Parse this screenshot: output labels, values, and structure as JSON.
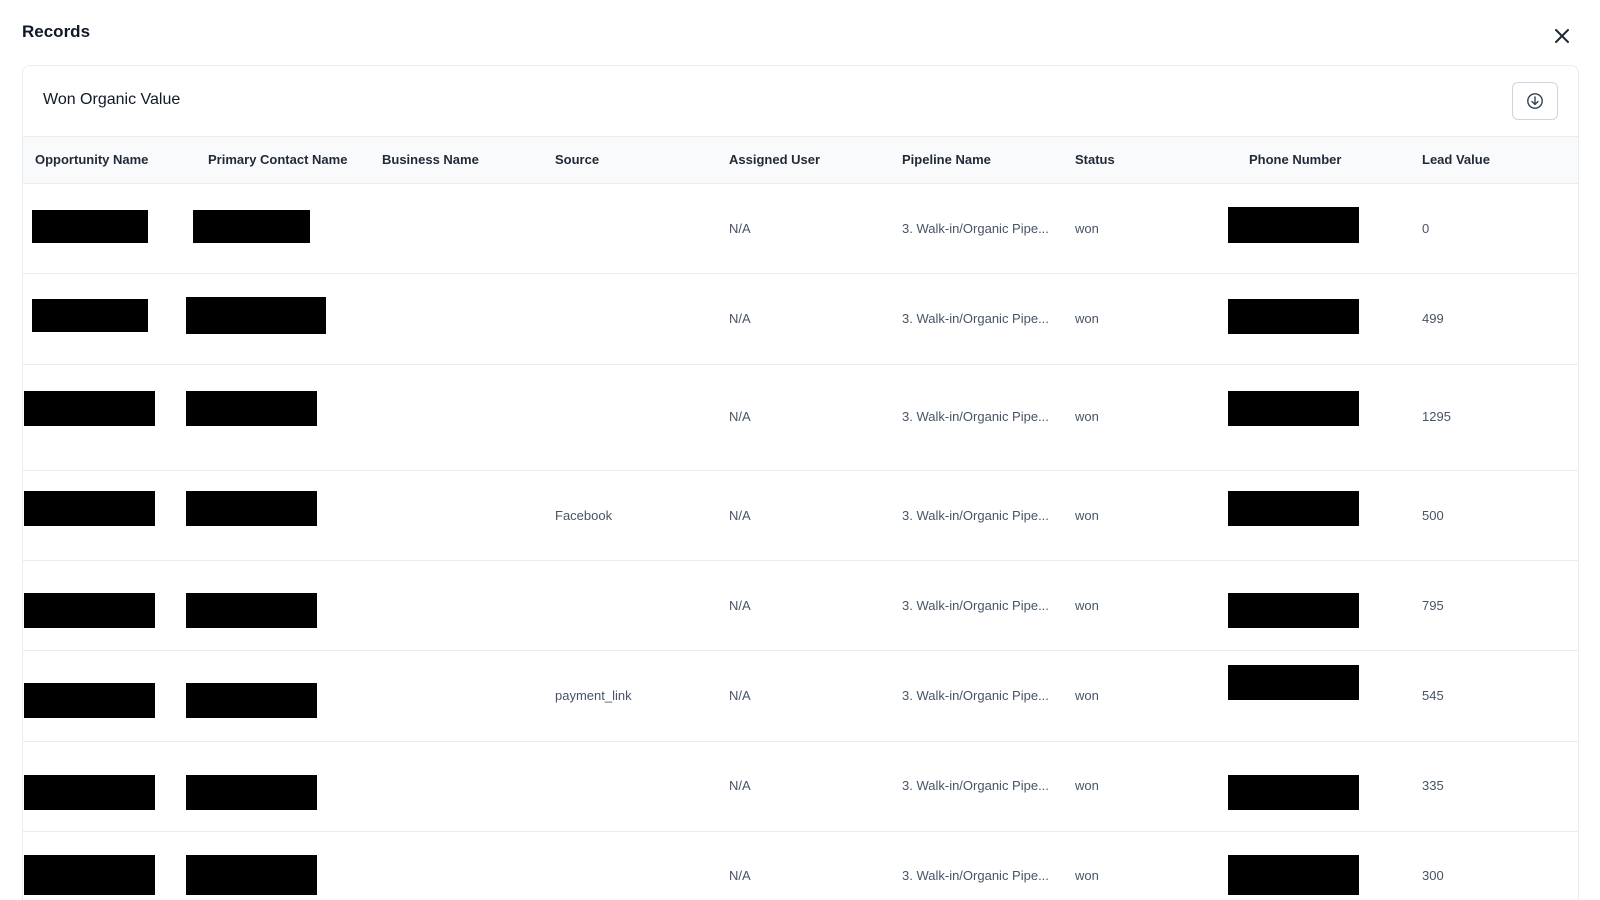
{
  "modal": {
    "title": "Records"
  },
  "card": {
    "title": "Won Organic Value"
  },
  "icons": {
    "close": "close-icon",
    "download": "download-icon"
  },
  "table": {
    "columns": [
      "Opportunity Name",
      "Primary Contact Name",
      "Business Name",
      "Source",
      "Assigned User",
      "Pipeline Name",
      "Status",
      "Phone Number",
      "Lead Value"
    ],
    "rows": [
      {
        "source": "",
        "assigned_user": "N/A",
        "pipeline": "3. Walk-in/Organic Pipe...",
        "status": "won",
        "lead_value": "0"
      },
      {
        "source": "",
        "assigned_user": "N/A",
        "pipeline": "3. Walk-in/Organic Pipe...",
        "status": "won",
        "lead_value": "499"
      },
      {
        "source": "",
        "assigned_user": "N/A",
        "pipeline": "3. Walk-in/Organic Pipe...",
        "status": "won",
        "lead_value": "1295"
      },
      {
        "source": "Facebook",
        "assigned_user": "N/A",
        "pipeline": "3. Walk-in/Organic Pipe...",
        "status": "won",
        "lead_value": "500"
      },
      {
        "source": "",
        "assigned_user": "N/A",
        "pipeline": "3. Walk-in/Organic Pipe...",
        "status": "won",
        "lead_value": "795"
      },
      {
        "source": "payment_link",
        "assigned_user": "N/A",
        "pipeline": "3. Walk-in/Organic Pipe...",
        "status": "won",
        "lead_value": "545"
      },
      {
        "source": "",
        "assigned_user": "N/A",
        "pipeline": "3. Walk-in/Organic Pipe...",
        "status": "won",
        "lead_value": "335"
      },
      {
        "source": "",
        "assigned_user": "N/A",
        "pipeline": "3. Walk-in/Organic Pipe...",
        "status": "won",
        "lead_value": "300"
      }
    ]
  }
}
